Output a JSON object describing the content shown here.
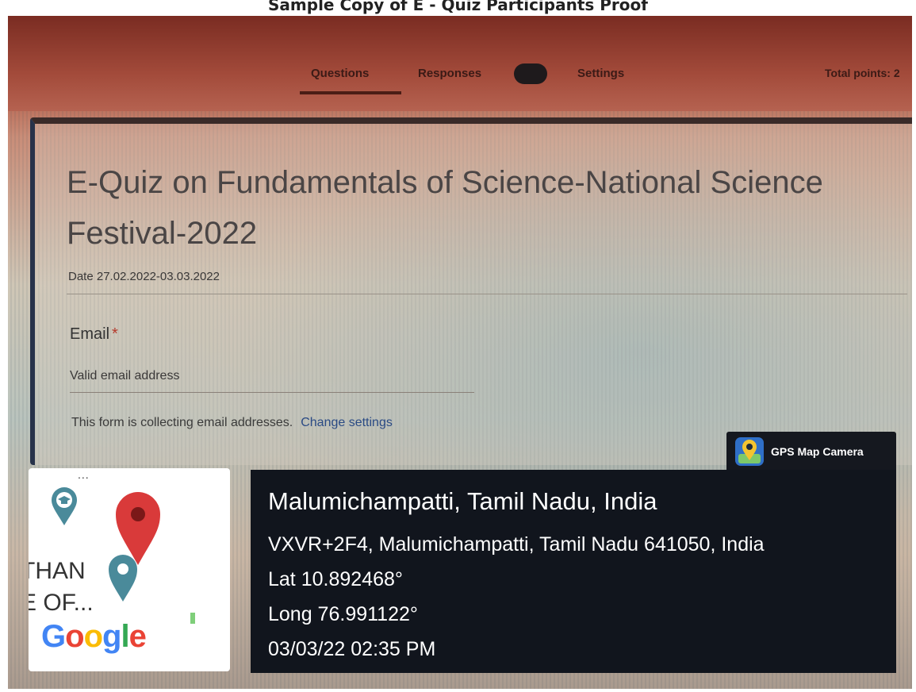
{
  "document": {
    "caption": "Sample Copy of E - Quiz Participants Proof"
  },
  "form_app": {
    "tabs": [
      {
        "label": "Questions",
        "active": true
      },
      {
        "label": "Responses"
      },
      {
        "label": "Settings"
      }
    ],
    "total_points": "Total points: 2",
    "title": "E-Quiz on Fundamentals of Science-National Science Festival-2022",
    "date_text": "Date 27.02.2022-03.03.2022",
    "email": {
      "label": "Email",
      "required_mark": "*",
      "placeholder": "Valid email address"
    },
    "collecting_notice": "This form is collecting email addresses.",
    "change_settings_link": "Change settings"
  },
  "map_thumbnail": {
    "menu": "...",
    "partial_text_lines": [
      "THAN",
      "E OF..."
    ],
    "google_logo": "Google",
    "pin_icons": [
      "graduation-cap-pin-icon",
      "red-map-pin-icon",
      "blue-map-pin-icon"
    ]
  },
  "gps_camera": {
    "app_name": "GPS Map Camera",
    "location_title": "Malumichampatti, Tamil Nadu, India",
    "address": "VXVR+2F4, Malumichampatti, Tamil Nadu 641050, India",
    "latitude": "Lat 10.892468°",
    "longitude": "Long 76.991122°",
    "timestamp": "03/03/22 02:35 PM"
  },
  "colors": {
    "overlay_bg": "#11151d",
    "google_blue": "#4285f4",
    "google_red": "#ea4335",
    "google_yellow": "#fbbc05",
    "google_green": "#34a853",
    "pin_teal": "#4a8a9a"
  }
}
